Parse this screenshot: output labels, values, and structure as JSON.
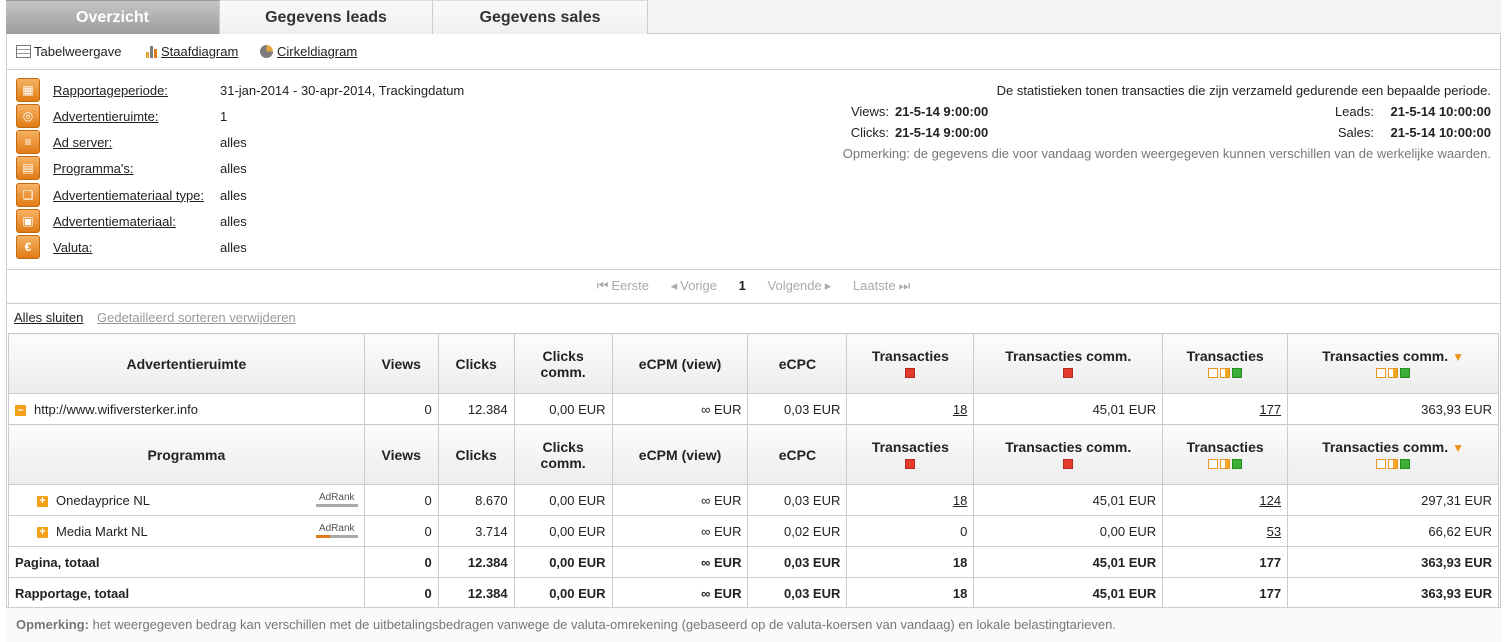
{
  "tabs": [
    {
      "label": "Overzicht",
      "active": true
    },
    {
      "label": "Gegevens leads",
      "active": false
    },
    {
      "label": "Gegevens sales",
      "active": false
    }
  ],
  "views": {
    "table": "Tabelweergave",
    "bar": "Staafdiagram",
    "pie": "Cirkeldiagram"
  },
  "filters": [
    {
      "icon": "calendar-icon",
      "label": "Rapportageperiode:",
      "value": "31-jan-2014 - 30-apr-2014, Trackingdatum"
    },
    {
      "icon": "adspace-icon",
      "label": "Advertentieruimte:",
      "value": "1"
    },
    {
      "icon": "adserver-icon",
      "label": "Ad server:",
      "value": "alles"
    },
    {
      "icon": "program-icon",
      "label": "Programma's:",
      "value": "alles"
    },
    {
      "icon": "material-type-icon",
      "label": "Advertentiemateriaal type:",
      "value": "alles"
    },
    {
      "icon": "material-icon",
      "label": "Advertentiemateriaal:",
      "value": "alles"
    },
    {
      "icon": "euro-icon",
      "label": "Valuta:",
      "value": "alles"
    }
  ],
  "stats": {
    "intro": "De statistieken tonen transacties die zijn verzameld gedurende een bepaalde periode.",
    "views_label": "Views:",
    "views_value": "21-5-14 9:00:00",
    "leads_label": "Leads:",
    "leads_value": "21-5-14 10:00:00",
    "clicks_label": "Clicks:",
    "clicks_value": "21-5-14 9:00:00",
    "sales_label": "Sales:",
    "sales_value": "21-5-14 10:00:00",
    "note": "Opmerking: de gegevens die voor vandaag worden weergegeven kunnen verschillen van de werkelijke waarden."
  },
  "pager": {
    "first": "Eerste",
    "prev": "Vorige",
    "current": "1",
    "next": "Volgende",
    "last": "Laatste"
  },
  "actions": {
    "close_all": "Alles sluiten",
    "remove_sort": "Gedetailleerd sorteren verwijderen"
  },
  "table": {
    "header1": {
      "col0": "Advertentieruimte",
      "views": "Views",
      "clicks": "Clicks",
      "clicks_comm": "Clicks comm.",
      "ecpm": "eCPM (view)",
      "ecpc": "eCPC",
      "trans": "Transacties",
      "trans_comm": "Transacties comm.",
      "trans2": "Transacties",
      "trans_comm2": "Transacties comm."
    },
    "space_row": {
      "name": "http://www.wifiversterker.info",
      "views": "0",
      "clicks": "12.384",
      "clicks_comm": "0,00 EUR",
      "ecpm": "∞ EUR",
      "ecpc": "0,03 EUR",
      "trans": "18",
      "trans_comm": "45,01 EUR",
      "trans2": "177",
      "trans_comm2": "363,93 EUR"
    },
    "header2": {
      "col0": "Programma",
      "views": "Views",
      "clicks": "Clicks",
      "clicks_comm": "Clicks comm.",
      "ecpm": "eCPM (view)",
      "ecpc": "eCPC",
      "trans": "Transacties",
      "trans_comm": "Transacties comm.",
      "trans2": "Transacties",
      "trans_comm2": "Transacties comm."
    },
    "programs": [
      {
        "name": "Onedayprice NL",
        "adrank": "AdRank",
        "adrank_level": 0.0,
        "views": "0",
        "clicks": "8.670",
        "clicks_comm": "0,00 EUR",
        "ecpm": "∞ EUR",
        "ecpc": "0,03 EUR",
        "trans": "18",
        "trans_link": true,
        "trans_comm": "45,01 EUR",
        "trans2": "124",
        "trans_comm2": "297,31 EUR"
      },
      {
        "name": "Media Markt NL",
        "adrank": "AdRank",
        "adrank_level": 0.35,
        "views": "0",
        "clicks": "3.714",
        "clicks_comm": "0,00 EUR",
        "ecpm": "∞ EUR",
        "ecpc": "0,02 EUR",
        "trans": "0",
        "trans_link": false,
        "trans_comm": "0,00 EUR",
        "trans2": "53",
        "trans_comm2": "66,62 EUR"
      }
    ],
    "page_total": {
      "label": "Pagina, totaal",
      "views": "0",
      "clicks": "12.384",
      "clicks_comm": "0,00 EUR",
      "ecpm": "∞ EUR",
      "ecpc": "0,03 EUR",
      "trans": "18",
      "trans_comm": "45,01 EUR",
      "trans2": "177",
      "trans_comm2": "363,93 EUR"
    },
    "report_total": {
      "label": "Rapportage, totaal",
      "views": "0",
      "clicks": "12.384",
      "clicks_comm": "0,00 EUR",
      "ecpm": "∞ EUR",
      "ecpc": "0,03 EUR",
      "trans": "18",
      "trans_comm": "45,01 EUR",
      "trans2": "177",
      "trans_comm2": "363,93 EUR"
    }
  },
  "bottom_note": {
    "label": "Opmerking:",
    "text": " het weergegeven bedrag kan verschillen met de uitbetalingsbedragen vanwege de valuta-omrekening (gebaseerd op de valuta-koersen van vandaag) en lokale belastingtarieven."
  },
  "colors": {
    "accent_orange": "#e07b16",
    "status_red": "#e53b2c",
    "status_green": "#3cb034"
  }
}
